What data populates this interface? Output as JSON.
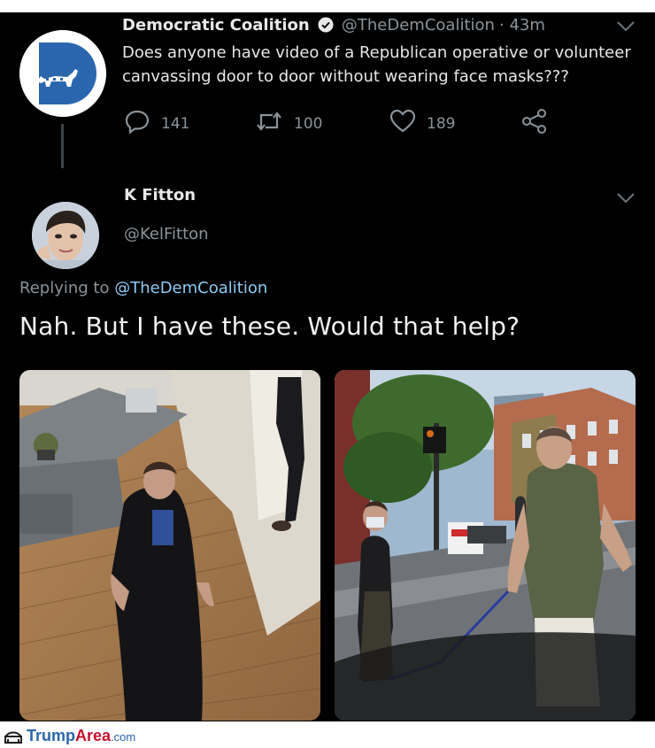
{
  "original_tweet": {
    "display_name": "Democratic Coalition",
    "handle": "@TheDemCoalition",
    "time": "· 43m",
    "text_line1": "Does anyone have video of a Republican operative or volunteer",
    "text_line2": "canvassing door to door without wearing face masks???",
    "reply_count": "141",
    "retweet_count": "100",
    "like_count": "189",
    "icons": [
      "verified-badge-icon",
      "chevron-down-icon",
      "reply-icon",
      "retweet-icon",
      "heart-icon",
      "share-icon"
    ]
  },
  "reply_tweet": {
    "display_name": "K Fitton",
    "handle": "@KelFitton",
    "replying_prefix": "Replying to",
    "replying_handle": "@TheDemCoalition",
    "text": "Nah. But I have these. Would that help?"
  },
  "footer": {
    "brand_a": "Trump",
    "brand_b": "Area",
    "brand_c": ".com"
  },
  "colors": {
    "background": "#000000",
    "text": "#e8e8e8",
    "muted": "#8b9399",
    "link": "#8ecbf4",
    "brand_blue": "#2a66ad",
    "footer_red": "#c8102e"
  }
}
